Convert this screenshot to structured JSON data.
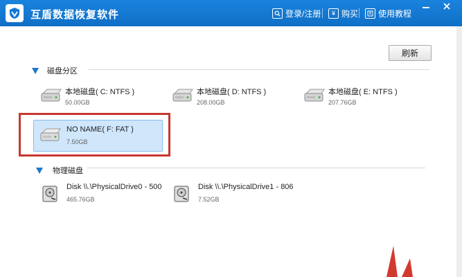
{
  "app": {
    "title": "互盾数据恢复软件"
  },
  "toolbar": {
    "login_label": "登录/注册",
    "buy_label": "购买",
    "tutorial_label": "使用教程",
    "login_icon": "search-icon",
    "buy_icon": "yen-icon",
    "tutorial_icon": "book-icon"
  },
  "main": {
    "refresh_label": "刷新",
    "partitions": {
      "title": "磁盘分区",
      "drives": [
        {
          "name": "本地磁盘( C: NTFS )",
          "size": "50.00GB"
        },
        {
          "name": "本地磁盘( D: NTFS )",
          "size": "208.00GB"
        },
        {
          "name": "本地磁盘( E: NTFS )",
          "size": "207.76GB"
        },
        {
          "name": "NO NAME( F: FAT )",
          "size": "7.50GB",
          "selected": true
        }
      ]
    },
    "physical": {
      "title": "物理磁盘",
      "drives": [
        {
          "name": "Disk \\\\.\\PhysicalDrive0 - 500",
          "size": "465.76GB"
        },
        {
          "name": "Disk \\\\.\\PhysicalDrive1 - 806",
          "size": "7.52GB"
        }
      ]
    }
  },
  "colors": {
    "titlebar": "#1477d6",
    "accent": "#1f78c8",
    "selection": "#cfe6fb",
    "highlight": "#c7372f"
  }
}
